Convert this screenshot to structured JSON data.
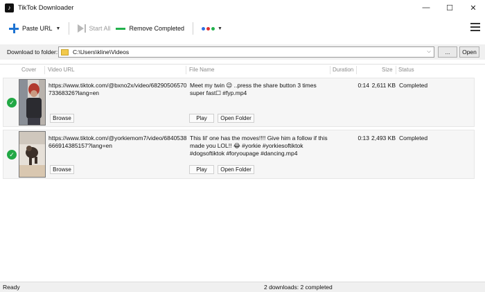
{
  "window": {
    "title": "TikTok Downloader",
    "icon_glyph": "♪",
    "minimize_glyph": "—",
    "maximize_glyph": "☐",
    "close_glyph": "✕"
  },
  "toolbar": {
    "paste_label": "Paste URL",
    "start_label": "Start All",
    "remove_label": "Remove Completed",
    "caret_glyph": "▼",
    "dot_colors": [
      "#2f6fe0",
      "#e02f2f",
      "#22b14c"
    ]
  },
  "folder": {
    "label": "Download to folder:",
    "path": "C:\\Users\\kline\\Videos",
    "browse_label": "...",
    "open_label": "Open",
    "arrow_glyph": "⌵"
  },
  "columns": {
    "cover": "Cover",
    "url": "Video URL",
    "file": "File Name",
    "duration": "Duration",
    "size": "Size",
    "status": "Status"
  },
  "rows": [
    {
      "url": "https://www.tiktok.com/@bxno2x/video/6829050657073368326?lang=en",
      "file": "Meet my twin 😉 ..press the share button 3 times super fast☐ #fyp.mp4",
      "duration": "0:14",
      "size": "2,611 KB",
      "status": "Completed",
      "browse_label": "Browse",
      "play_label": "Play",
      "open_folder_label": "Open Folder",
      "check_glyph": "✓"
    },
    {
      "url": "https://www.tiktok.com/@yorkiemom7/video/6840538666914385157?lang=en",
      "file": "This lil' one has the moves!!!! Give him a follow if this made you LOL!! 😂 #yorkie #yorkiesoftiktok #dogsoftiktok #foryoupage #dancing.mp4",
      "duration": "0:13",
      "size": "2,493 KB",
      "status": "Completed",
      "browse_label": "Browse",
      "play_label": "Play",
      "open_folder_label": "Open Folder",
      "check_glyph": "✓"
    }
  ],
  "statusbar": {
    "left": "Ready",
    "right": "2 downloads: 2 completed"
  }
}
